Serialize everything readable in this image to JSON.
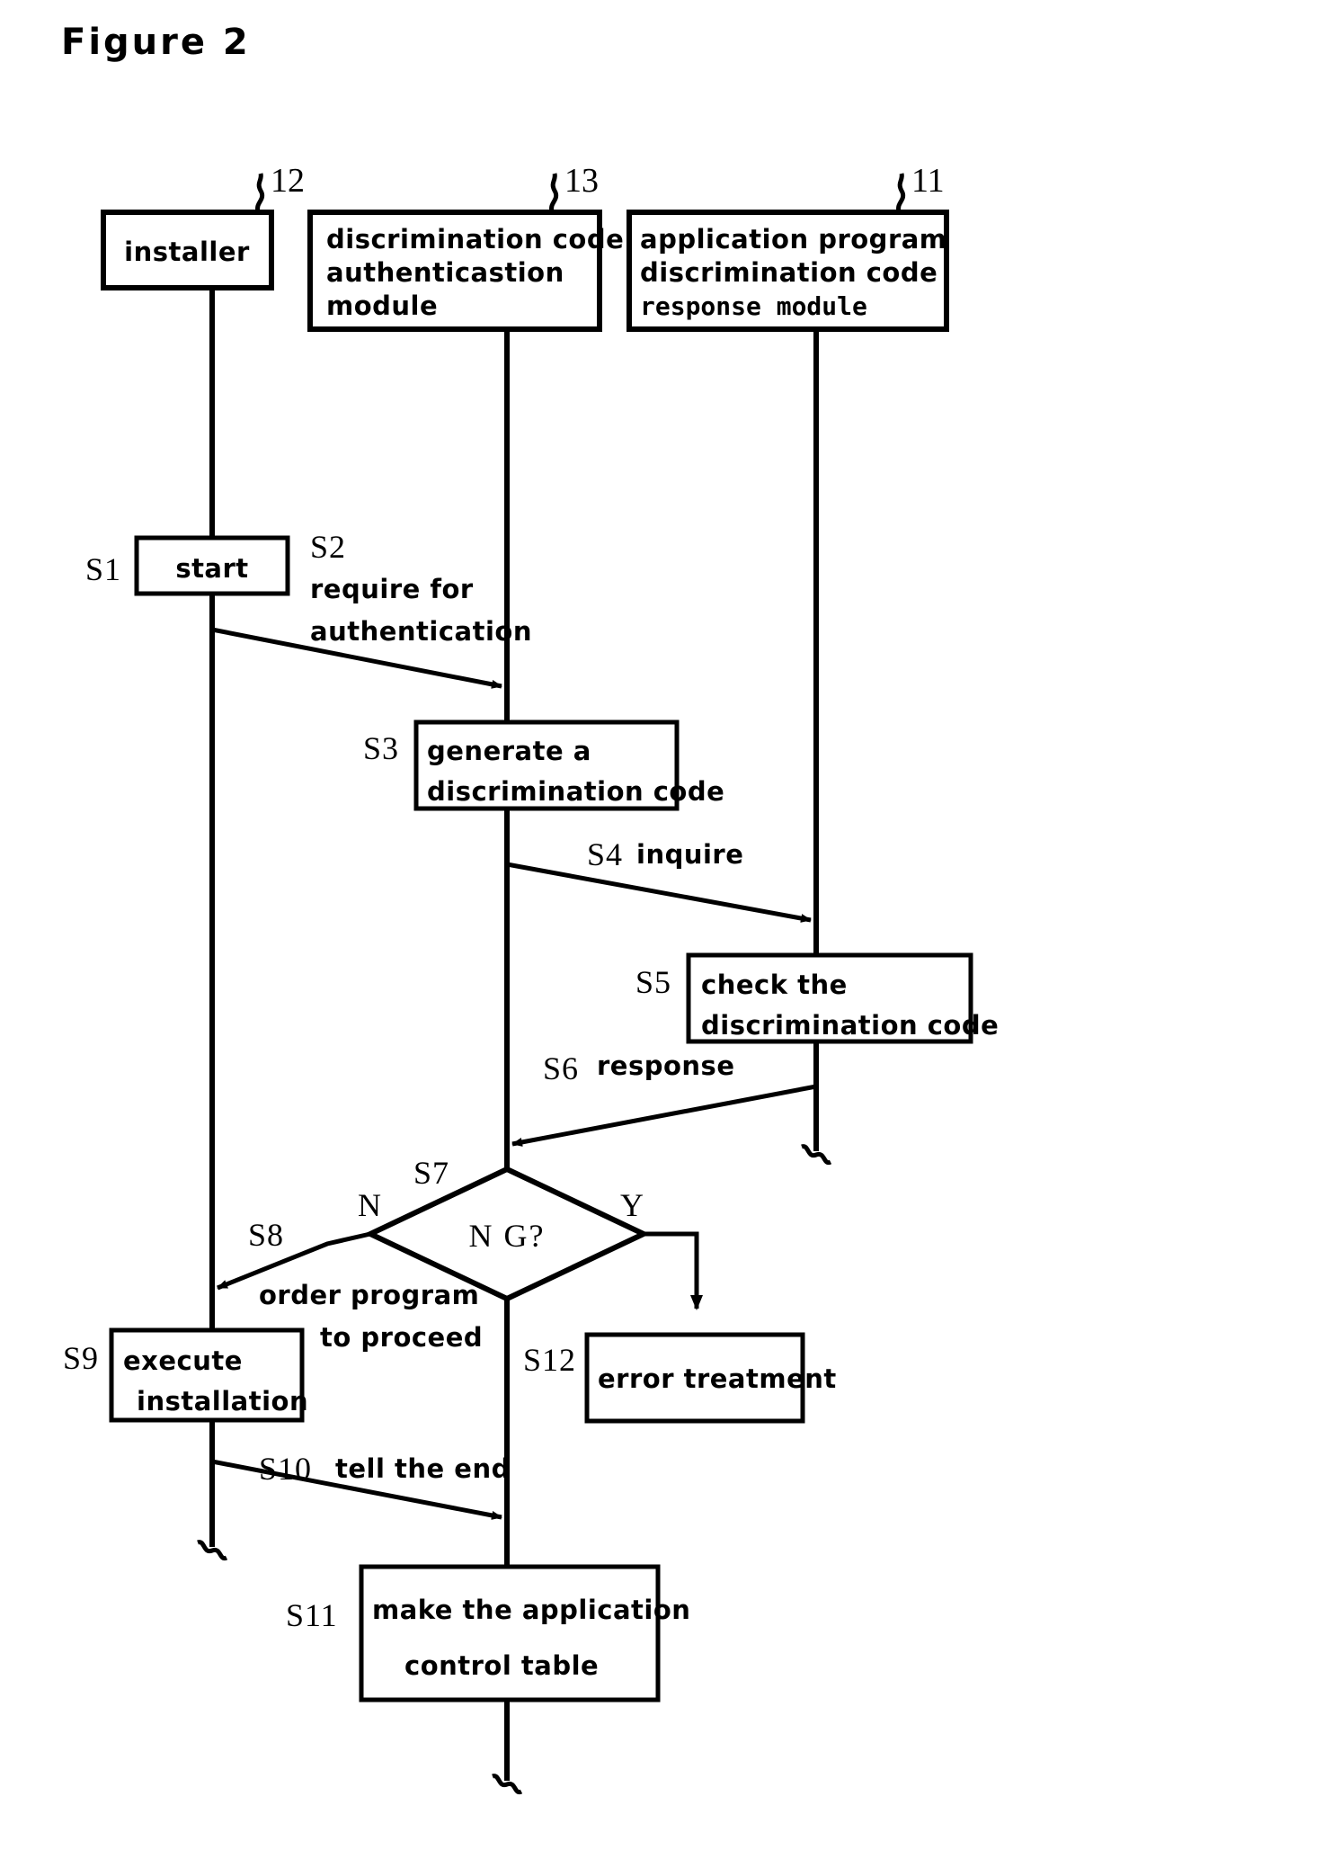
{
  "figure": {
    "title": "Figure  2"
  },
  "lifelines": [
    {
      "id": "installer",
      "ref": "12",
      "label_lines": [
        "installer"
      ]
    },
    {
      "id": "auth-module",
      "ref": "13",
      "label_lines": [
        "discrimination  code",
        "authenticastion",
        "module"
      ]
    },
    {
      "id": "response-module",
      "ref": "11",
      "label_lines": [
        "application  program",
        "discrimination  code",
        "response module"
      ]
    }
  ],
  "steps": {
    "s1": {
      "tag": "S1",
      "text": "start"
    },
    "s2": {
      "tag": "S2",
      "text_lines": [
        "require  for",
        "authentication"
      ]
    },
    "s3": {
      "tag": "S3",
      "text_lines": [
        "generate  a",
        "discrimination  code"
      ]
    },
    "s4": {
      "tag": "S4",
      "text": "inquire"
    },
    "s5": {
      "tag": "S5",
      "text_lines": [
        "check  the",
        "discrimination  code"
      ]
    },
    "s6": {
      "tag": "S6",
      "text": "response"
    },
    "s7": {
      "tag": "S7",
      "text": "N G?",
      "branch_no": "N",
      "branch_yes": "Y"
    },
    "s8": {
      "tag": "S8",
      "text_lines": [
        "order  program",
        "to  proceed"
      ]
    },
    "s9": {
      "tag": "S9",
      "text_lines": [
        "execute",
        "installation"
      ]
    },
    "s10": {
      "tag": "S10",
      "text": "tell  the  end"
    },
    "s11": {
      "tag": "S11",
      "text_lines": [
        "make  the  application",
        "control  table"
      ]
    },
    "s12": {
      "tag": "S12",
      "text": "error treatment"
    }
  }
}
